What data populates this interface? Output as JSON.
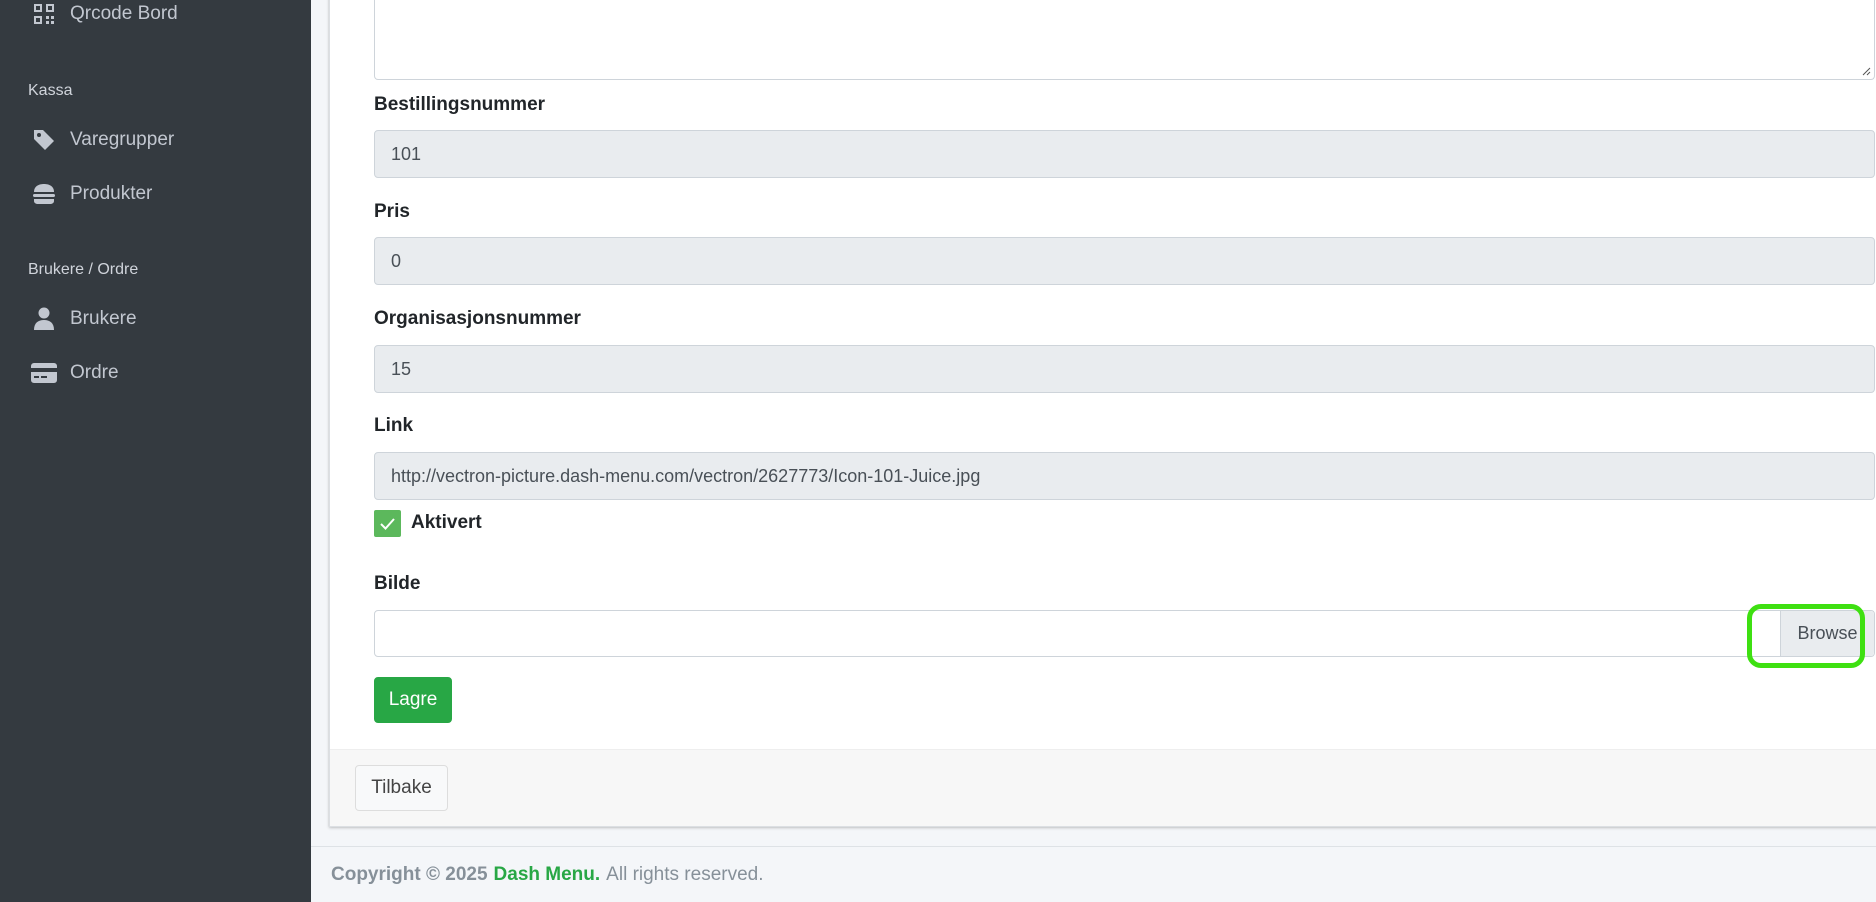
{
  "sidebar": {
    "items": [
      {
        "label": "Qrcode Bord",
        "icon": "qrcode-icon"
      },
      {
        "label": "Varegrupper",
        "icon": "tag-icon"
      },
      {
        "label": "Produkter",
        "icon": "hamburger-icon"
      },
      {
        "label": "Brukere",
        "icon": "user-icon"
      },
      {
        "label": "Ordre",
        "icon": "credit-card-icon"
      }
    ],
    "headers": [
      "Kassa",
      "Brukere / Ordre"
    ]
  },
  "form": {
    "order_number_label": "Bestillingsnummer",
    "order_number_value": "101",
    "price_label": "Pris",
    "price_value": "0",
    "org_number_label": "Organisasjonsnummer",
    "org_number_value": "15",
    "link_label": "Link",
    "link_value": "http://vectron-picture.dash-menu.com/vectron/2627773/Icon-101-Juice.jpg",
    "activated_label": "Aktivert",
    "activated_checked": true,
    "image_label": "Bilde",
    "browse_label": "Browse",
    "save_label": "Lagre",
    "back_label": "Tilbake"
  },
  "footer": {
    "copyright": "Copyright © 2025",
    "brand": "Dash Menu.",
    "rights": "All rights reserved."
  },
  "colors": {
    "sidebar_bg": "#343a40",
    "success": "#28a745",
    "checkbox": "#5cb85c",
    "highlight": "#3ee011"
  }
}
